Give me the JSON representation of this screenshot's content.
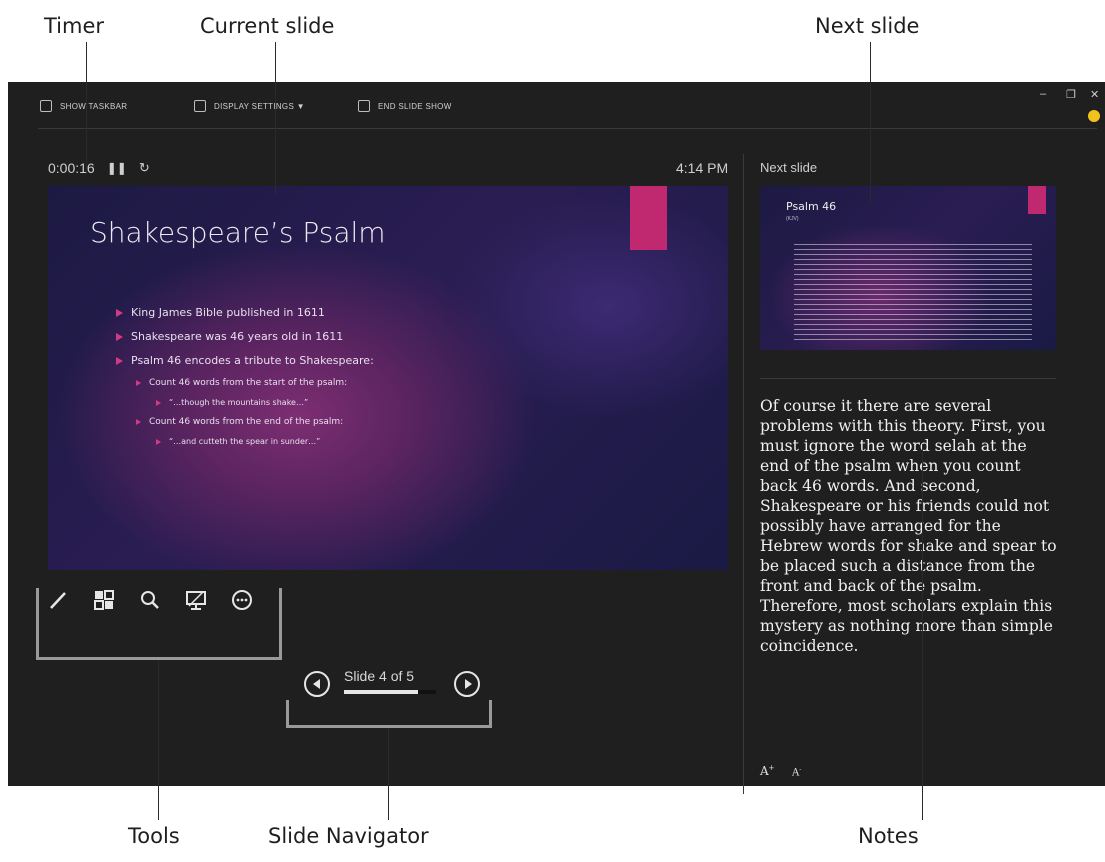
{
  "callouts": {
    "timer": "Timer",
    "current_slide": "Current slide",
    "next_slide": "Next slide",
    "tools": "Tools",
    "slide_navigator": "Slide Navigator",
    "notes": "Notes"
  },
  "topbar": {
    "show_taskbar": "SHOW TASKBAR",
    "display_settings": "DISPLAY SETTINGS ▼",
    "end_slide_show": "END SLIDE SHOW"
  },
  "timer": {
    "elapsed": "0:00:16",
    "pause_icon": "pause-icon",
    "reset_icon": "reset-icon"
  },
  "clock": "4:14 PM",
  "next_slide_label": "Next slide",
  "current_slide": {
    "title": "Shakespeare’s Psalm",
    "bullets": [
      "King James Bible published in 1611",
      "Shakespeare was 46 years old in 1611",
      "Psalm 46 encodes a tribute to Shakespeare:",
      "Count 46 words from the start of the psalm:",
      "“…though the mountains shake…”",
      "Count 46 words from the end of the psalm:",
      "“…and cutteth the spear in sunder…”"
    ],
    "accent_color": "#c0286f"
  },
  "next_slide": {
    "title": "Psalm 46",
    "subtitle": "(KJV)"
  },
  "notes": {
    "text": "Of course it there are several problems with this theory. First, you must ignore the word selah at the end of the psalm when you count back 46 words. And second, Shakespeare or his friends could not possibly have arranged for the Hebrew words for shake and spear to be placed such a distance from the front and back of the psalm. Therefore, most scholars explain this mystery as nothing more than simple coincidence."
  },
  "tools": [
    "pen-icon",
    "slides-grid-icon",
    "zoom-icon",
    "black-screen-icon",
    "more-options-icon"
  ],
  "navigator": {
    "label": "Slide 4 of 5",
    "current": 4,
    "total": 5,
    "progress": 0.8
  },
  "font_controls": {
    "increase": "A",
    "decrease": "A"
  }
}
